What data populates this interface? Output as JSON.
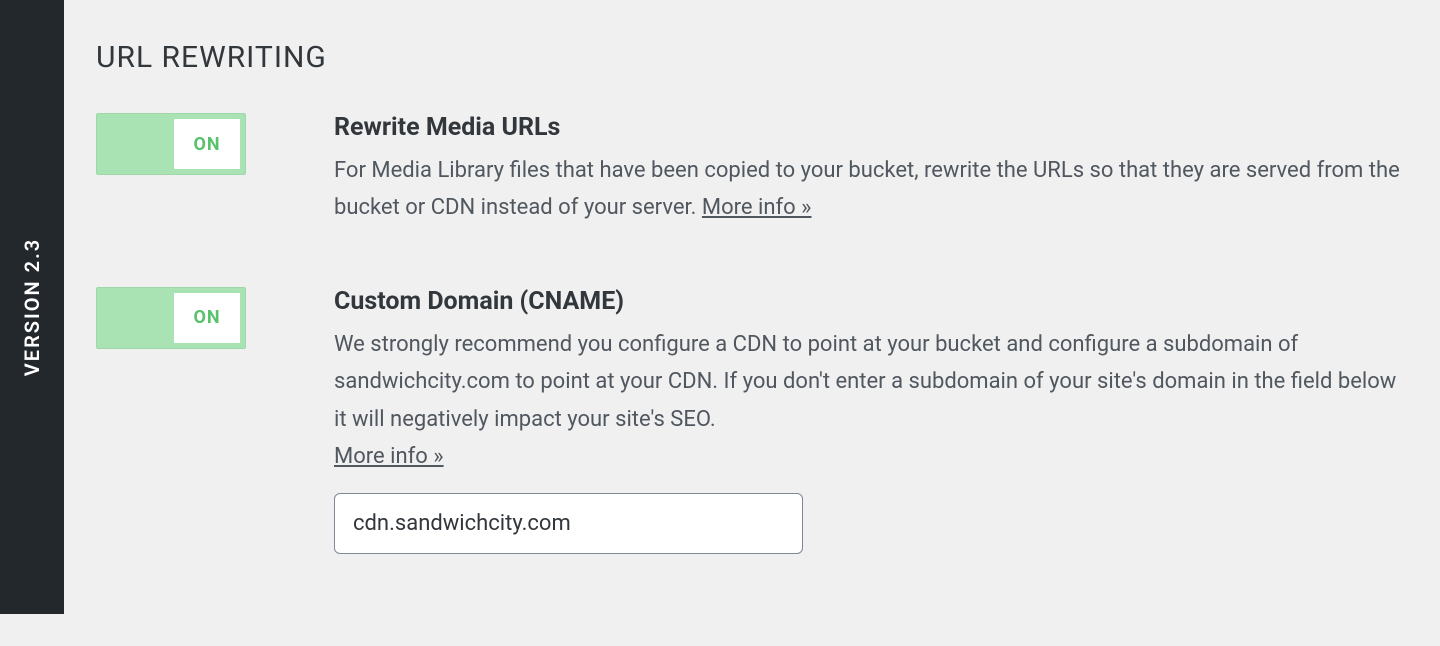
{
  "sidebar": {
    "version_label": "VERSION 2.3"
  },
  "section": {
    "title": "URL REWRITING"
  },
  "settings": [
    {
      "key": "rewrite-media-urls",
      "toggle_state_label": "ON",
      "toggle_on": true,
      "title": "Rewrite Media URLs",
      "description_prefix": "For Media Library files that have been copied to your bucket, rewrite the URLs so that they are served from the bucket or CDN instead of your server. ",
      "more_info_label": "More info »"
    },
    {
      "key": "custom-domain-cname",
      "toggle_state_label": "ON",
      "toggle_on": true,
      "title": "Custom Domain (CNAME)",
      "description_prefix": "We strongly recommend you configure a CDN to point at your bucket and configure a subdomain of sandwichcity.com to point at your CDN. If you don't enter a subdomain of your site's domain in the field below it will negatively impact your site's SEO. ",
      "more_info_label": "More info »",
      "input_value": "cdn.sandwichcity.com"
    }
  ]
}
